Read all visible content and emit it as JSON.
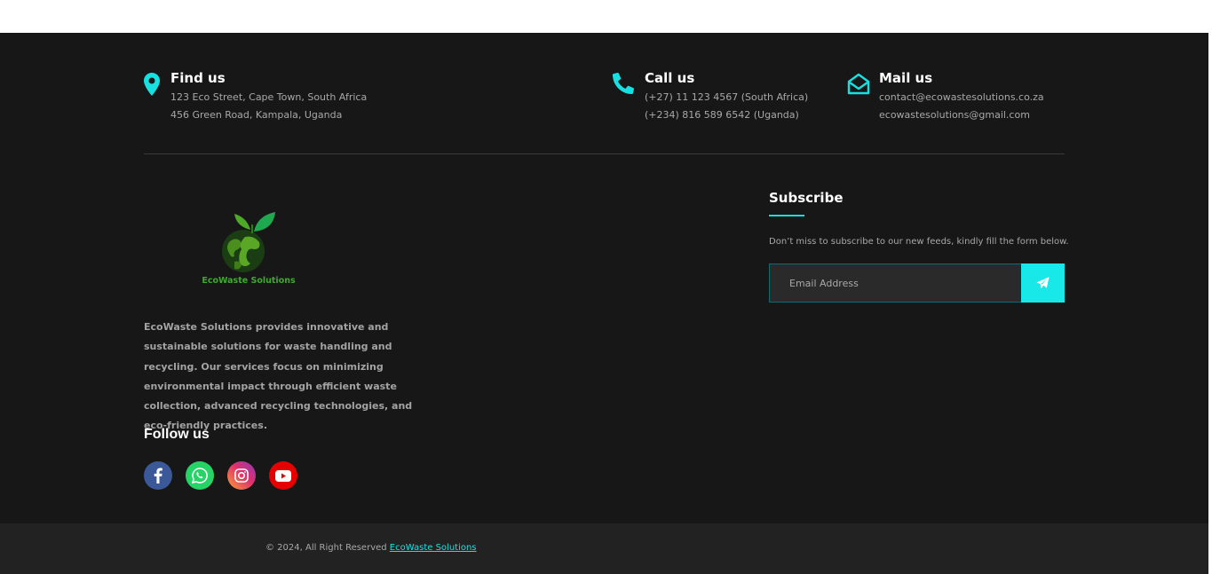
{
  "contact": {
    "find": {
      "title": "Find us",
      "line1": "123 Eco Street, Cape Town, South Africa",
      "line2": "456 Green Road, Kampala, Uganda",
      "icon": "map-marker-icon"
    },
    "call": {
      "title": "Call us",
      "line1": "(+27) 11 123 4567 (South Africa)",
      "line2": "(+234) 816 589 6542 (Uganda)",
      "icon": "phone-icon"
    },
    "mail": {
      "title": "Mail us",
      "line1": "contact@ecowastesolutions.co.za",
      "line2": "ecowastesolutions@gmail.com",
      "icon": "envelope-open-icon"
    }
  },
  "logo": {
    "text": "EcoWaste Solutions"
  },
  "about": {
    "text": "EcoWaste Solutions provides innovative and sustainable solutions for waste handling and recycling. Our services focus on minimizing environmental impact through efficient waste collection, advanced recycling technologies, and eco-friendly practices."
  },
  "follow": {
    "title": "Follow us",
    "networks": [
      {
        "name": "facebook",
        "color": "#3b5998"
      },
      {
        "name": "whatsapp",
        "color": "#25d366"
      },
      {
        "name": "instagram",
        "color": "#c13584"
      },
      {
        "name": "youtube",
        "color": "#e60000"
      }
    ]
  },
  "subscribe": {
    "title": "Subscribe",
    "description": "Don’t miss to subscribe to our new feeds, kindly fill the form below.",
    "placeholder": "Email Address"
  },
  "footer": {
    "copyright": "© 2024, All Right Reserved ",
    "link": "EcoWaste Solutions"
  },
  "colors": {
    "accent": "#19e0e0",
    "background": "#171717",
    "bottom_bar": "#222222"
  }
}
